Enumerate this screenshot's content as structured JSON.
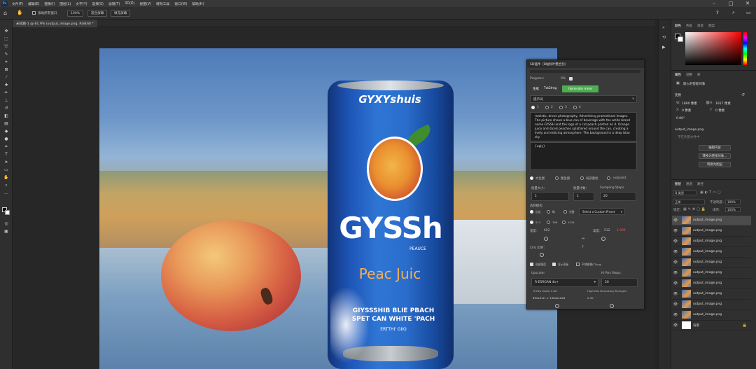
{
  "menubar": {
    "logo": "Ps",
    "items": [
      "文件(F)",
      "编辑(E)",
      "图像(I)",
      "图层(L)",
      "文字(Y)",
      "选择(S)",
      "滤镜(T)",
      "3D(D)",
      "视图(V)",
      "增效工具",
      "窗口(W)",
      "帮助(H)"
    ]
  },
  "options": {
    "hand_label": "滚动所有窗口",
    "zoom": "100%",
    "fit": "适合屏幕",
    "fill": "填充屏幕"
  },
  "document": {
    "tab": "未标题-1 @ 81.9% (output_image.png, RGB/8) *"
  },
  "can": {
    "top_text": "GYXYshuis",
    "brand": "GYSSh",
    "sub": "PEAUCE",
    "flavor": "Peac Juic",
    "line1": "GIYSSSHIB BLIE PBACH",
    "line2": "SPET CAN WHITE 'PACH",
    "line3": "ERTTHI' GIIO"
  },
  "sd": {
    "title": "SD插件（B站秋叶整合包）",
    "progress_label": "Progress:",
    "progress_value": "0%",
    "tab_gen": "生成",
    "tab_txt2img": "Txt2Img",
    "generate": "Generate more",
    "prompt_label": "提示词",
    "prompt_tabs": [
      "1",
      "2",
      "3",
      "4"
    ],
    "prompt": "realistic, drone photography, Advertising promotional images. The picture shows a blue can of beverage with the white brand name GYSSH and the logo of a cut peach printed on it. Orange juice and diced peaches splattered around the can, creating a lively and enticing atmosphere. The background is a deep blue sky",
    "negative": "{ugly}",
    "modes": [
      "文生图",
      "图生图",
      "局部重绘",
      "outpaint"
    ],
    "batch_size_label": "批量大小：",
    "batch_size": "1",
    "batch_count_label": "批量计数：",
    "batch_count": "1",
    "steps_label": "Sampling Steps",
    "steps": "20",
    "model_label": "选择模式：",
    "model_opts": [
      "自定",
      "略",
      "完整"
    ],
    "preset": "Select a Custom Preset",
    "sizes": [
      "512",
      "768",
      "1024"
    ],
    "width_label": "宽度：",
    "width": "692",
    "height_label": "高度：",
    "height": "512",
    "lock": "1.000",
    "cfg_label": "CFG 比例：",
    "cfg": "7",
    "check1": "创建图层",
    "check2": "显示面板",
    "check3": "平铺图像(Tiling)",
    "upscaler_label": "Upscaler",
    "upscaler": "R-ESRGAN 4x+",
    "hires_steps_label": "Hi Res Steps:",
    "hires_steps": "20",
    "hires_scale_label": "Hi Res Scale:",
    "hires_scale": "2.00",
    "denoise_label": "High Res Denoising Strength:",
    "denoise": "0.50",
    "size_result": "692x512 -> 1384x1024"
  },
  "right": {
    "top_tabs": [
      "颜色",
      "色板",
      "渐变",
      "图案"
    ],
    "prop_tabs": [
      "属性",
      "调整",
      "库"
    ],
    "prop_title": "嵌入的智能对象",
    "transform": "变换",
    "w_label": "W:",
    "w_val": "1890 像素",
    "h_label": "H:",
    "h_val": "1917 像素",
    "x_label": "X:",
    "x_val": "0 像素",
    "y_label": "Y:",
    "y_val": "0 像素",
    "angle": "0.00°",
    "file": "output_image.png",
    "file_sub": "不在外部文件中",
    "btn1": "编辑内容",
    "btn2": "转换为链接对象...",
    "btn3": "转换为图层",
    "layer_tabs": [
      "图层",
      "通道",
      "路径"
    ],
    "kind": "Q 类型",
    "blend": "正常",
    "opacity_label": "不透明度：",
    "opacity": "100%",
    "lock_label": "锁定：",
    "fill_label": "填充：",
    "fill": "100%",
    "layers": [
      "output_image.png",
      "output_image.png",
      "output_image.png",
      "output_image.png",
      "output_image.png",
      "output_image.png",
      "output_image.png",
      "output_image.png",
      "output_image.png",
      "output_image.png"
    ],
    "bg_layer": "背景"
  },
  "colors": {
    "accent": "#31a8ff",
    "generate_btn": "#4cae50",
    "panel": "#3a3a3a"
  }
}
